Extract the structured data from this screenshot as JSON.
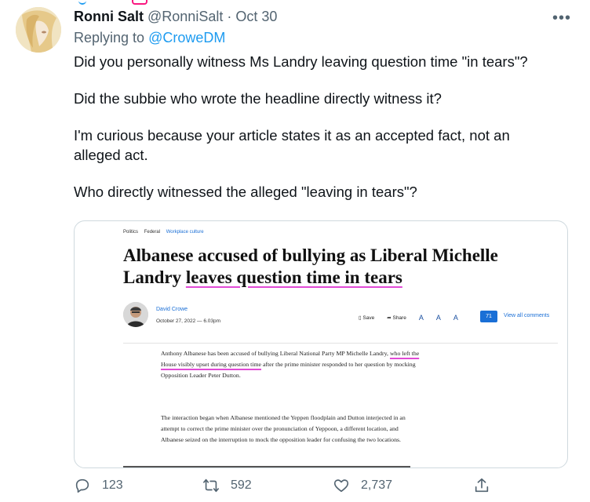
{
  "tweet": {
    "author_name": "Ronni Salt",
    "handle": "@RonniSalt",
    "separator": "·",
    "date": "Oct 30",
    "more_icon": "more-icon",
    "replying_prefix": "Replying to",
    "replying_to": "@CroweDM",
    "paragraphs": [
      "Did you personally witness Ms Landry leaving question time \"in tears\"?",
      "Did the subbie who wrote the headline directly witness it?",
      "I'm curious because your article states it as an accepted fact, not an alleged act.",
      "Who directly witnessed the alleged \"leaving in tears\"?"
    ]
  },
  "article_card": {
    "breadcrumbs": [
      "Politics",
      "Federal",
      "Workplace culture"
    ],
    "headline_part1": "Albanese accused of bullying as Liberal Michelle Landry ",
    "headline_part2": "leaves question time in tears",
    "author": "David Crowe",
    "date": "October 27, 2022 — 6.03pm",
    "save_label": "Save",
    "share_label": "Share",
    "font_sizes": [
      "A",
      "A",
      "A"
    ],
    "comment_count": "71",
    "view_comments": "View all comments",
    "para1_start": "Anthony Albanese has been accused of bullying Liberal National Party MP Michelle Landry, ",
    "para1_highlight": "who left the House visibly upset during question time",
    "para1_end": " after the prime minister responded to her question by mocking Opposition Leader Peter Dutton.",
    "para2": "The interaction began when Albanese mentioned the Yeppen floodplain and Dutton interjected in an attempt to correct the prime minister over the pronunciation of Yeppoon, a different location, and Albanese seized on the interruption to mock the opposition leader for confusing the two locations."
  },
  "actions": {
    "reply_count": "123",
    "retweet_count": "592",
    "like_count": "2,737"
  },
  "colors": {
    "accent": "#1d9bf0",
    "highlight": "#e14bd6",
    "muted": "#536471"
  }
}
